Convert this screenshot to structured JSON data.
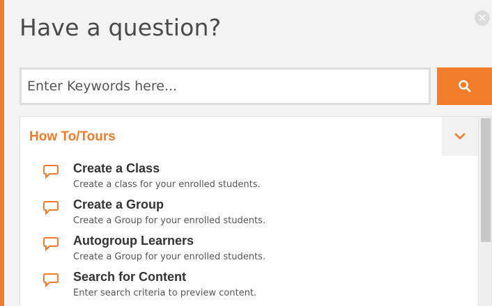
{
  "header": {
    "title": "Have a question?"
  },
  "search": {
    "placeholder": "Enter Keywords here...",
    "value": ""
  },
  "section": {
    "title": "How To/Tours"
  },
  "items": [
    {
      "title": "Create a Class",
      "description": "Create a class for your enrolled students."
    },
    {
      "title": "Create a Group",
      "description": "Create a Group for your enrolled students."
    },
    {
      "title": "Autogroup Learners",
      "description": "Create a Group for your enrolled students."
    },
    {
      "title": "Search for Content",
      "description": "Enter search criteria to preview content."
    }
  ],
  "icons": {
    "close": "close-icon",
    "search": "search-icon",
    "chevron": "chevron-down-icon",
    "item": "speech-bubble-icon"
  },
  "colors": {
    "accent": "#f07c2a",
    "panel": "#f3f3f3",
    "text": "#333333"
  }
}
